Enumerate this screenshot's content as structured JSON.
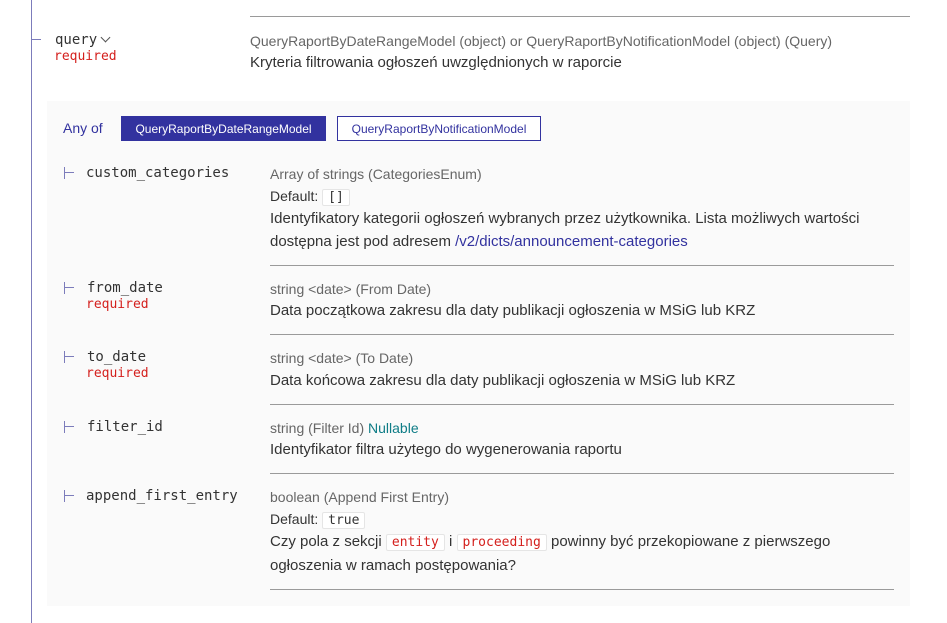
{
  "params": {
    "query": {
      "name": "query",
      "required": "required",
      "type_line": "QueryRaportByDateRangeModel (object) or QueryRaportByNotificationModel (object) (Query)",
      "description": "Kryteria filtrowania ogłoszeń uwzględnionych w raporcie"
    }
  },
  "anyof": {
    "label": "Any of",
    "tabs": [
      "QueryRaportByDateRangeModel",
      "QueryRaportByNotificationModel"
    ],
    "active_index": 0
  },
  "fields": {
    "custom_categories": {
      "name": "custom_categories",
      "type_line": "Array of strings (CategoriesEnum)",
      "default_label": "Default:",
      "default_value": "[]",
      "description": "Identyfikatory kategorii ogłoszeń wybranych przez użytkownika. Lista możliwych wartości dostępna jest pod adresem ",
      "link_text": "/v2/dicts/announcement-categories"
    },
    "from_date": {
      "name": "from_date",
      "required": "required",
      "type_line": "string <date> (From Date)",
      "description": "Data początkowa zakresu dla daty publikacji ogłoszenia w MSiG lub KRZ"
    },
    "to_date": {
      "name": "to_date",
      "required": "required",
      "type_line": "string <date> (To Date)",
      "description": "Data końcowa zakresu dla daty publikacji ogłoszenia w MSiG lub KRZ"
    },
    "filter_id": {
      "name": "filter_id",
      "type_line": "string (Filter Id)",
      "nullable": "Nullable",
      "description": "Identyfikator filtra użytego do wygenerowania raportu"
    },
    "append_first_entry": {
      "name": "append_first_entry",
      "type_line": "boolean (Append First Entry)",
      "default_label": "Default:",
      "default_value": "true",
      "desc_part1": "Czy pola z sekcji",
      "code1": "entity",
      "desc_and": "i",
      "code2": "proceeding",
      "desc_part2": "powinny być przekopiowane z pierwszego ogłoszenia w ramach postępowania?"
    }
  },
  "colors": {
    "accent": "#32329f",
    "required": "#d41f1c",
    "nullable": "#0e7c86",
    "panel_bg": "#fafafa",
    "tree_line": "#7c7cbb"
  },
  "icons": {
    "query_toggle": "chevron-down-icon"
  }
}
